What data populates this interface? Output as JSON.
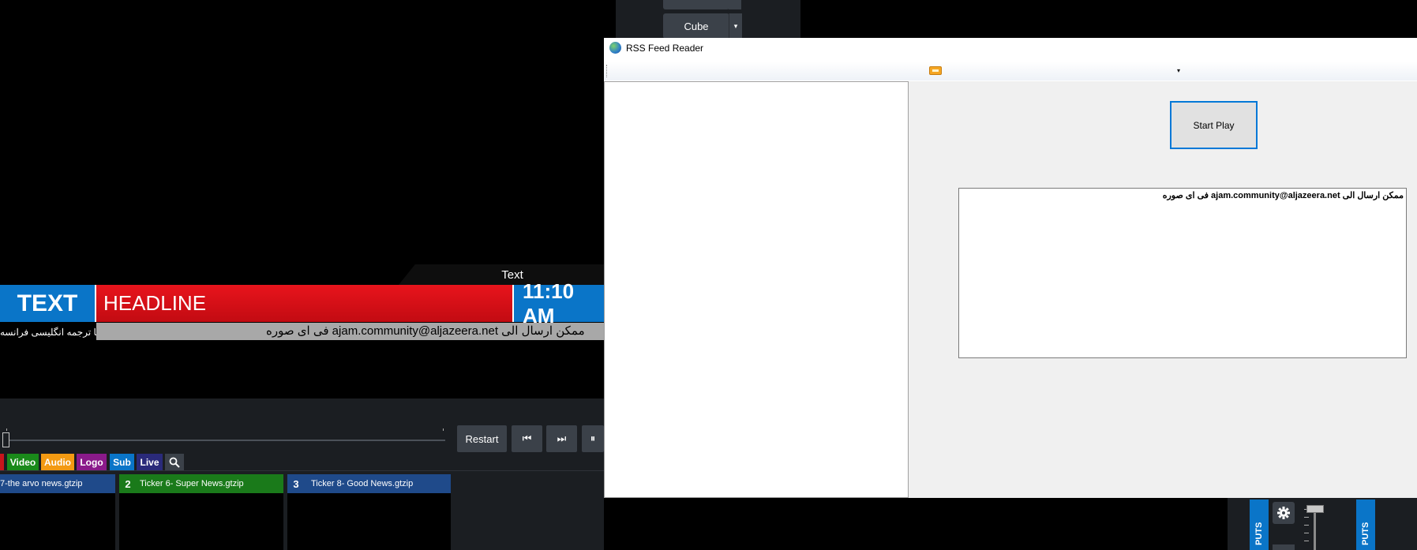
{
  "top_panel": {
    "cube_label": "Cube",
    "dropdown_glyph": "▾"
  },
  "preview": {
    "tab_label": "Text",
    "text_block": "TEXT",
    "headline": "HEADLINE",
    "time": "11:10 AM",
    "ticker_left": "یا ترجمه انگلیسی فرانسه",
    "ticker_main": "فی ای صوره  ajam.community@aljazeera.net ممکن ارسال الی"
  },
  "transport": {
    "restart_label": "Restart",
    "prev_glyph": "⏮",
    "next_glyph": "⏭",
    "pause_glyph": "⏸"
  },
  "filters": [
    {
      "label": "Video",
      "color": "#1a8a1a"
    },
    {
      "label": "Audio",
      "color": "#f39a12"
    },
    {
      "label": "Logo",
      "color": "#8a1a8a"
    },
    {
      "label": "Sub",
      "color": "#0a75c8"
    },
    {
      "label": "Live",
      "color": "#2a2a7a"
    }
  ],
  "search_icon": "search-icon",
  "slots": [
    {
      "num": "",
      "name": "7-the arvo news.gtzip",
      "color": "#1f4a8a"
    },
    {
      "num": "2",
      "name": "Ticker 6- Super News.gtzip",
      "color": "#1a7a1a"
    },
    {
      "num": "3",
      "name": "Ticker 8- Good News.gtzip",
      "color": "#1f4a8a"
    }
  ],
  "right_panel": {
    "tab_left": "PUTS",
    "tab_right": "PUTS",
    "gear_icon": "gear-icon"
  },
  "rss": {
    "title": "RSS Feed Reader",
    "toolbar_dropdown": "▾",
    "start_button": "Start Play",
    "output_text": "ممکن ارسال الی ajam.community@aljazeera.net  فی ای صوره"
  }
}
